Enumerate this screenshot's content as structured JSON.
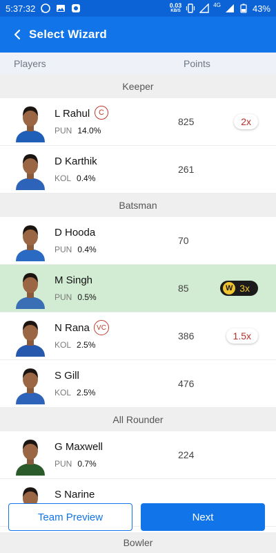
{
  "status_bar": {
    "time": "5:37:32",
    "net_speed": "0.03",
    "net_unit": "KB/S",
    "network": "4G",
    "battery": "43%"
  },
  "app_bar": {
    "title": "Select Wizard"
  },
  "columns": {
    "players": "Players",
    "points": "Points"
  },
  "sections": [
    {
      "title": "Keeper",
      "players": [
        {
          "name": "L Rahul",
          "team": "PUN",
          "pct": "14.0%",
          "points": "825",
          "role": "C",
          "multiplier": "2x",
          "wizard": false,
          "highlight": false,
          "jersey": "#1f5fb8"
        },
        {
          "name": "D Karthik",
          "team": "KOL",
          "pct": "0.4%",
          "points": "261",
          "role": "",
          "multiplier": "",
          "wizard": false,
          "highlight": false,
          "jersey": "#2d63b8"
        }
      ]
    },
    {
      "title": "Batsman",
      "players": [
        {
          "name": "D Hooda",
          "team": "PUN",
          "pct": "0.4%",
          "points": "70",
          "role": "",
          "multiplier": "",
          "wizard": false,
          "highlight": false,
          "jersey": "#2a6ac2"
        },
        {
          "name": "M Singh",
          "team": "PUN",
          "pct": "0.5%",
          "points": "85",
          "role": "",
          "multiplier": "3x",
          "wizard": true,
          "highlight": true,
          "jersey": "#3a6fb5"
        },
        {
          "name": "N Rana",
          "team": "KOL",
          "pct": "2.5%",
          "points": "386",
          "role": "VC",
          "multiplier": "1.5x",
          "wizard": false,
          "highlight": false,
          "jersey": "#2659ad"
        },
        {
          "name": "S Gill",
          "team": "KOL",
          "pct": "2.5%",
          "points": "476",
          "role": "",
          "multiplier": "",
          "wizard": false,
          "highlight": false,
          "jersey": "#2d63b8"
        }
      ]
    },
    {
      "title": "All Rounder",
      "players": [
        {
          "name": "G Maxwell",
          "team": "PUN",
          "pct": "0.7%",
          "points": "224",
          "role": "",
          "multiplier": "",
          "wizard": false,
          "highlight": false,
          "jersey": "#2b5b2b"
        },
        {
          "name": "S Narine",
          "team": "",
          "pct": "",
          "points": "",
          "role": "",
          "multiplier": "",
          "wizard": false,
          "highlight": false,
          "jersey": "#3a4c8a"
        }
      ]
    }
  ],
  "buttons": {
    "team_preview": "Team Preview",
    "next": "Next"
  },
  "bottom_section": {
    "title": "Bowler"
  },
  "icons": {
    "back": "chevron-left-icon",
    "wizard": "wizard-w-icon"
  }
}
